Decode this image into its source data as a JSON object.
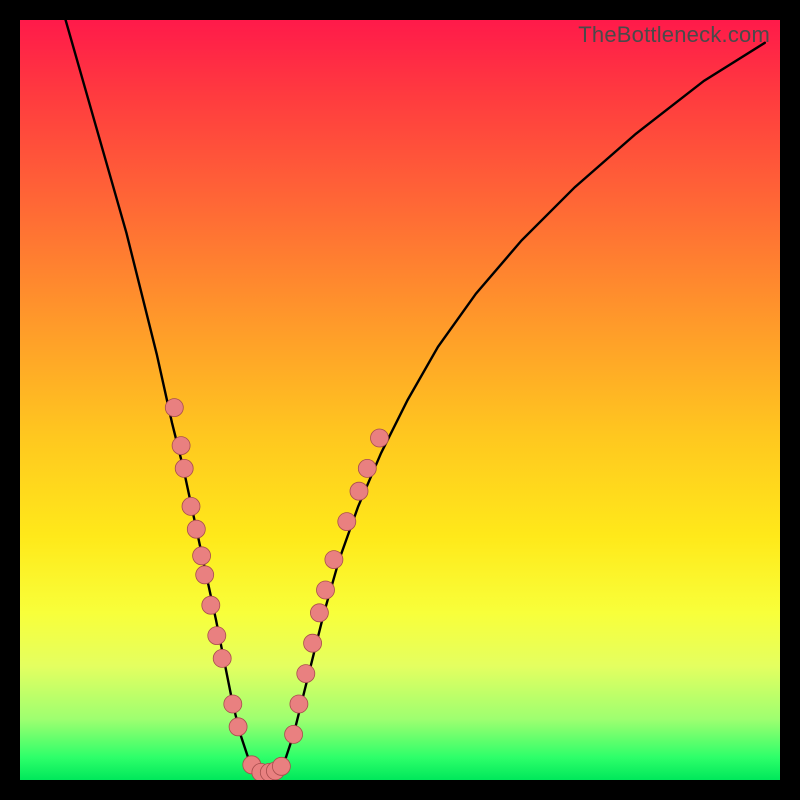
{
  "watermark": "TheBottleneck.com",
  "chart_data": {
    "type": "line",
    "title": "",
    "xlabel": "",
    "ylabel": "",
    "xlim": [
      0,
      100
    ],
    "ylim": [
      0,
      100
    ],
    "curve": {
      "x": [
        6,
        8,
        10,
        12,
        14,
        16,
        18,
        20,
        21.5,
        23,
        24.5,
        25.8,
        27,
        28,
        29,
        30,
        31,
        32,
        33,
        34,
        35,
        36,
        37,
        38.5,
        40,
        42,
        44.5,
        47.5,
        51,
        55,
        60,
        66,
        73,
        81,
        90,
        98
      ],
      "y": [
        100,
        93,
        86,
        79,
        72,
        64,
        56,
        47,
        41,
        34,
        27,
        21,
        15,
        10,
        6,
        3,
        1.5,
        1,
        1,
        1.5,
        3,
        6,
        10,
        16,
        22,
        29,
        36,
        43,
        50,
        57,
        64,
        71,
        78,
        85,
        92,
        97
      ]
    },
    "markers": [
      {
        "x": 20.3,
        "y": 49
      },
      {
        "x": 21.2,
        "y": 44
      },
      {
        "x": 21.6,
        "y": 41
      },
      {
        "x": 22.5,
        "y": 36
      },
      {
        "x": 23.2,
        "y": 33
      },
      {
        "x": 23.9,
        "y": 29.5
      },
      {
        "x": 24.3,
        "y": 27
      },
      {
        "x": 25.1,
        "y": 23
      },
      {
        "x": 25.9,
        "y": 19
      },
      {
        "x": 26.6,
        "y": 16
      },
      {
        "x": 28.0,
        "y": 10
      },
      {
        "x": 28.7,
        "y": 7
      },
      {
        "x": 30.5,
        "y": 2
      },
      {
        "x": 31.7,
        "y": 1
      },
      {
        "x": 32.8,
        "y": 1
      },
      {
        "x": 33.6,
        "y": 1.2
      },
      {
        "x": 34.4,
        "y": 1.8
      },
      {
        "x": 36.0,
        "y": 6
      },
      {
        "x": 36.7,
        "y": 10
      },
      {
        "x": 37.6,
        "y": 14
      },
      {
        "x": 38.5,
        "y": 18
      },
      {
        "x": 39.4,
        "y": 22
      },
      {
        "x": 40.2,
        "y": 25
      },
      {
        "x": 41.3,
        "y": 29
      },
      {
        "x": 43.0,
        "y": 34
      },
      {
        "x": 44.6,
        "y": 38
      },
      {
        "x": 45.7,
        "y": 41
      },
      {
        "x": 47.3,
        "y": 45
      }
    ],
    "marker_color": "#e98080"
  }
}
